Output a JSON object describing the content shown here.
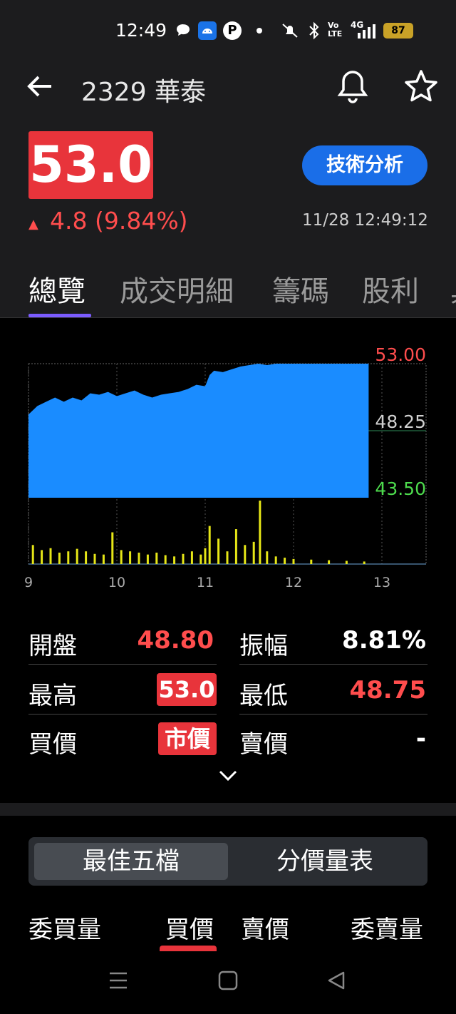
{
  "status_bar": {
    "time": "12:49",
    "network": "4G",
    "volte": "Vo LTE",
    "battery": "87",
    "icons": [
      "chat-icon",
      "android-icon",
      "p-app-icon",
      "dot-icon",
      "mute-icon",
      "bluetooth-icon",
      "volte-icon",
      "signal-icon",
      "battery-icon"
    ]
  },
  "header": {
    "title": "2329 華泰",
    "back_icon": "back-arrow-icon",
    "bell_icon": "bell-icon",
    "star_icon": "star-icon"
  },
  "quote": {
    "price": "53.0",
    "change": "4.8 (9.84%)",
    "change_arrow": "▲",
    "timestamp": "11/28 12:49:12",
    "tech_button": "技術分析",
    "up_color": "#ff4d4d",
    "price_bg": "#e8343b",
    "accent": "#1a6ee8"
  },
  "tabs": [
    {
      "label": "總覽",
      "active": true
    },
    {
      "label": "成交明細",
      "active": false
    },
    {
      "label": "籌碼",
      "active": false
    },
    {
      "label": "股利",
      "active": false
    },
    {
      "label": "具",
      "active": false
    }
  ],
  "chart_data": {
    "type": "area",
    "price_axis": {
      "top": "53.00",
      "mid": "48.25",
      "bottom": "43.50"
    },
    "ylim": [
      43.5,
      53.0
    ],
    "x_ticks": [
      "9",
      "10",
      "11",
      "12",
      "13"
    ],
    "xlim": [
      9,
      13.5
    ],
    "price_series": {
      "x": [
        9.0,
        9.1,
        9.2,
        9.3,
        9.4,
        9.5,
        9.6,
        9.7,
        9.8,
        9.9,
        10.0,
        10.1,
        10.2,
        10.3,
        10.4,
        10.5,
        10.6,
        10.7,
        10.8,
        10.9,
        11.0,
        11.05,
        11.1,
        11.2,
        11.3,
        11.4,
        11.5,
        11.6,
        11.7,
        11.8,
        11.9,
        12.0,
        12.5,
        12.85
      ],
      "y": [
        49.4,
        50.0,
        50.3,
        50.6,
        50.3,
        50.6,
        50.4,
        50.9,
        50.8,
        51.0,
        50.7,
        50.9,
        51.1,
        50.8,
        50.6,
        50.8,
        50.9,
        51.0,
        51.2,
        51.5,
        51.4,
        52.2,
        52.5,
        52.4,
        52.6,
        52.8,
        52.9,
        53.0,
        52.9,
        53.0,
        53.0,
        53.0,
        53.0,
        53.0
      ]
    },
    "volume_series": {
      "x": [
        9.05,
        9.15,
        9.25,
        9.35,
        9.45,
        9.55,
        9.65,
        9.75,
        9.85,
        9.95,
        10.05,
        10.15,
        10.25,
        10.35,
        10.45,
        10.55,
        10.65,
        10.75,
        10.85,
        10.95,
        11.0,
        11.05,
        11.15,
        11.25,
        11.35,
        11.45,
        11.55,
        11.62,
        11.7,
        11.8,
        11.9,
        12.0,
        12.2,
        12.4,
        12.6,
        12.8
      ],
      "y": [
        30,
        22,
        25,
        18,
        20,
        24,
        20,
        16,
        15,
        50,
        22,
        20,
        18,
        15,
        18,
        14,
        12,
        16,
        20,
        15,
        25,
        60,
        40,
        20,
        55,
        30,
        35,
        100,
        20,
        12,
        10,
        8,
        7,
        6,
        5,
        4
      ]
    },
    "colors": {
      "area": "#1a8cff",
      "volume": "#e6e617",
      "top_label": "#ff4d4d",
      "mid_label": "#d0d0d0",
      "bottom_label": "#4ddb4d"
    }
  },
  "stats": {
    "open_label": "開盤",
    "open_value": "48.80",
    "amplitude_label": "振幅",
    "amplitude_value": "8.81%",
    "high_label": "最高",
    "high_value": "53.0",
    "low_label": "最低",
    "low_value": "48.75",
    "bid_label": "買價",
    "bid_value": "市價",
    "ask_label": "賣價",
    "ask_value": "-",
    "expand_icon": "chevron-down-icon"
  },
  "order_book": {
    "segments": [
      {
        "label": "最佳五檔",
        "active": true
      },
      {
        "label": "分價量表",
        "active": false
      }
    ],
    "columns": [
      "委買量",
      "買價",
      "賣價",
      "委賣量"
    ]
  },
  "nav": {
    "icons": [
      "menu-icon",
      "home-icon",
      "back-icon"
    ]
  }
}
